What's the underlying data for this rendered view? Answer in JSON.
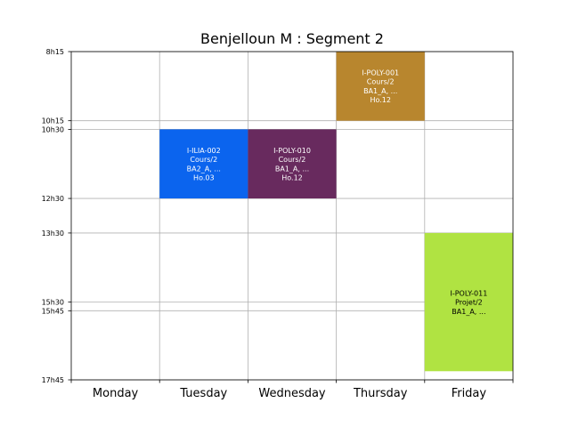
{
  "chart_data": {
    "type": "timetable",
    "title": "Benjelloun M : Segment 2",
    "days": [
      "Monday",
      "Tuesday",
      "Wednesday",
      "Thursday",
      "Friday"
    ],
    "ylim_minutes": [
      495,
      1065
    ],
    "y_ticks": [
      {
        "label": "8h15",
        "minutes": 495
      },
      {
        "label": "10h15",
        "minutes": 615
      },
      {
        "label": "10h30",
        "minutes": 630
      },
      {
        "label": "12h30",
        "minutes": 750
      },
      {
        "label": "13h30",
        "minutes": 810
      },
      {
        "label": "15h30",
        "minutes": 930
      },
      {
        "label": "15h45",
        "minutes": 945
      },
      {
        "label": "17h45",
        "minutes": 1065
      }
    ],
    "grid": true,
    "events": [
      {
        "day": "Thursday",
        "start": "8h15",
        "end": "10h15",
        "color": "#b8862e",
        "text_color": "#ffffff",
        "lines": [
          "I-POLY-001",
          "Cours/2",
          "BA1_A, ...",
          "Ho.12"
        ]
      },
      {
        "day": "Tuesday",
        "start": "10h30",
        "end": "12h30",
        "color": "#0b64ee",
        "text_color": "#ffffff",
        "lines": [
          "I-ILIA-002",
          "Cours/2",
          "BA2_A, ...",
          "Ho.03"
        ]
      },
      {
        "day": "Wednesday",
        "start": "10h30",
        "end": "12h30",
        "color": "#682a5e",
        "text_color": "#ffffff",
        "lines": [
          "I-POLY-010",
          "Cours/2",
          "BA1_A, ...",
          "Ho.12"
        ]
      },
      {
        "day": "Friday",
        "start": "13h30",
        "end": "17h30",
        "color": "#b0e342",
        "text_color": "#000000",
        "lines": [
          "I-POLY-011",
          "Projet/2",
          "BA1_A, ..."
        ]
      }
    ]
  }
}
